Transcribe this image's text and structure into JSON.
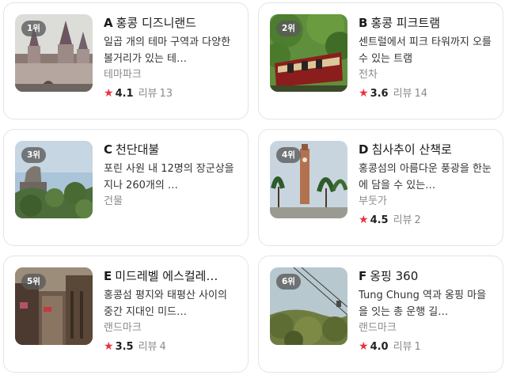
{
  "cards": [
    {
      "rank": "1위",
      "letter": "A",
      "name": "홍콩 디즈니랜드",
      "desc": "일곱 개의 테마 구역과 다양한 볼거리가 있는 테…",
      "category": "테마파크",
      "score": "4.1",
      "review_label": "리뷰",
      "review_count": "13",
      "image": "disney-castle"
    },
    {
      "rank": "2위",
      "letter": "B",
      "name": "홍콩 피크트램",
      "desc": "센트럴에서 피크 타워까지 오를 수 있는 트램",
      "category": "전차",
      "score": "3.6",
      "review_label": "리뷰",
      "review_count": "14",
      "image": "peak-tram"
    },
    {
      "rank": "3위",
      "letter": "C",
      "name": "천단대불",
      "desc": "포린 사원 내 12명의 장군상을 지나 260개의 …",
      "category": "건물",
      "image": "big-buddha"
    },
    {
      "rank": "4위",
      "letter": "D",
      "name": "침사추이 산책로",
      "desc": "홍콩섬의 아름다운 풍광을 한눈에 담을 수 있는…",
      "category": "부둣가",
      "score": "4.5",
      "review_label": "리뷰",
      "review_count": "2",
      "image": "clock-tower"
    },
    {
      "rank": "5위",
      "letter": "E",
      "name": "미드레벨 에스컬레…",
      "desc": "홍콩섬 평지와 태평산 사이의 중간 지대인 미드…",
      "category": "랜드마크",
      "score": "3.5",
      "review_label": "리뷰",
      "review_count": "4",
      "image": "escalator-street"
    },
    {
      "rank": "6위",
      "letter": "F",
      "name": "옹핑 360",
      "desc": "Tung Chung 역과 옹핑 마을을 잇는 총 운행 길…",
      "category": "랜드마크",
      "score": "4.0",
      "review_label": "리뷰",
      "review_count": "1",
      "image": "cable-car"
    }
  ],
  "colors": {
    "star": "#e8343e",
    "border": "#e4e4e4",
    "muted": "#8a8a8a"
  }
}
